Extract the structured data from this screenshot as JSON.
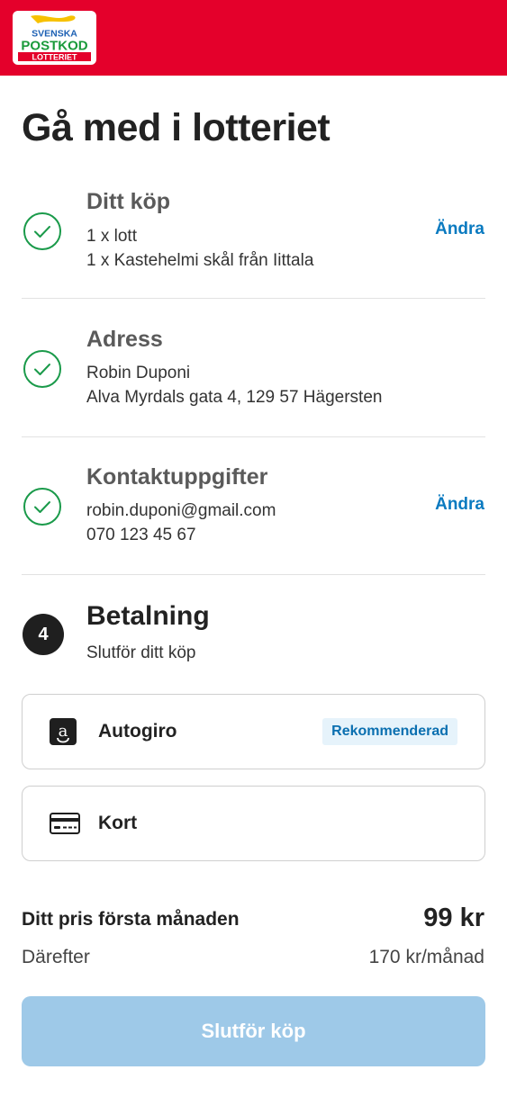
{
  "brand": {
    "line1": "SVENSKA",
    "line2": "POSTKOD",
    "line3": "LOTTERIET",
    "header_color": "#e4002b"
  },
  "page_title": "Gå med i lotteriet",
  "steps": [
    {
      "title": "Ditt köp",
      "lines": [
        "1 x lott",
        "1 x Kastehelmi skål från Iittala"
      ],
      "change_label": "Ändra",
      "status_icon": "check-circle-icon"
    },
    {
      "title": "Adress",
      "lines": [
        "Robin Duponi",
        "Alva Myrdals gata 4, 129 57 Hägersten"
      ],
      "status_icon": "check-circle-icon"
    },
    {
      "title": "Kontaktuppgifter",
      "lines": [
        "robin.duponi@gmail.com",
        "070 123 45 67"
      ],
      "change_label": "Ändra",
      "status_icon": "check-circle-icon"
    }
  ],
  "payment": {
    "step_number": "4",
    "title": "Betalning",
    "subtitle": "Slutför ditt köp",
    "options": [
      {
        "label": "Autogiro",
        "badge": "Rekommenderad",
        "icon": "autogiro-icon"
      },
      {
        "label": "Kort",
        "icon": "credit-card-icon"
      }
    ]
  },
  "pricing": {
    "first_month_label": "Ditt pris första månaden",
    "first_month_value": "99 kr",
    "after_label": "Därefter",
    "after_value": "170 kr/månad"
  },
  "submit_label": "Slutför köp",
  "colors": {
    "accent": "#0a7ac0",
    "check": "#1a9a4a",
    "submit_disabled": "#9ec9e8"
  }
}
